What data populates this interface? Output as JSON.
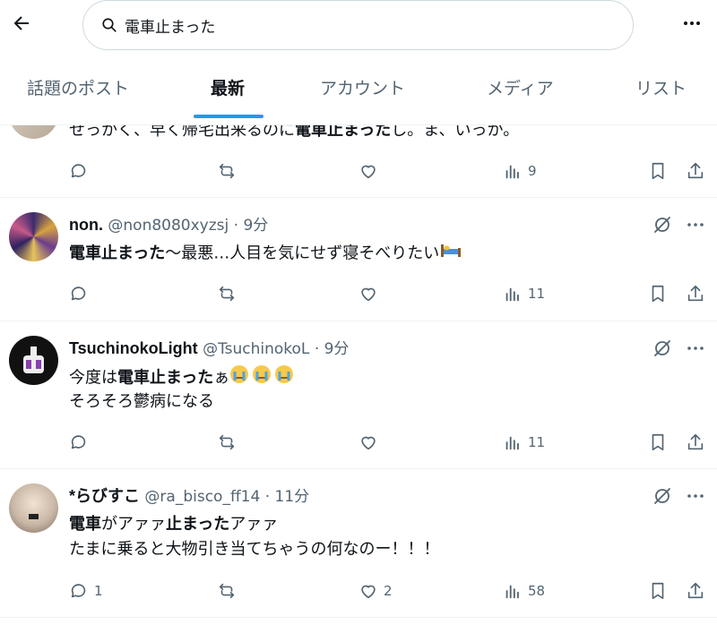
{
  "search": {
    "query": "電車止まった"
  },
  "tabs": [
    {
      "label": "話題のポスト"
    },
    {
      "label": "最新"
    },
    {
      "label": "アカウント"
    },
    {
      "label": "メディア"
    },
    {
      "label": "リスト"
    }
  ],
  "tweets": [
    {
      "text_pre": "せっかく、早く帰宅出来るのに",
      "text_bold": "電車止まった",
      "text_post": "し。ま、いっか。",
      "replies": "",
      "likes": "",
      "views": "9"
    },
    {
      "name": "non.",
      "handle": "@non8080xyzsj",
      "time": "· 9分",
      "text_bold": "電車止まった",
      "text_post": "〜最悪…人目を気にせず寝そべりたい",
      "replies": "",
      "likes": "",
      "views": "11"
    },
    {
      "name": "TsuchinokoLight",
      "handle": "@TsuchinokoL",
      "time": "· 9分",
      "text_pre": "今度は",
      "text_bold": "電車止まった",
      "text_post": "ぁ",
      "line2": "そろそろ鬱病になる",
      "replies": "",
      "likes": "",
      "views": "11"
    },
    {
      "name": "*らびすこ",
      "handle": "@ra_bisco_ff14",
      "time": "· 11分",
      "l1_a": "電車",
      "l1_b": "がアァァ",
      "l1_c": "止まった",
      "l1_d": "アァァ",
      "line2": "たまに乗ると大物引き当てちゃうの何なのー！！！",
      "replies": "1",
      "likes": "2",
      "views": "58"
    }
  ],
  "colors": {
    "accent": "#1d9bf0",
    "secondary_text": "#536471",
    "border": "#eff3f4"
  }
}
